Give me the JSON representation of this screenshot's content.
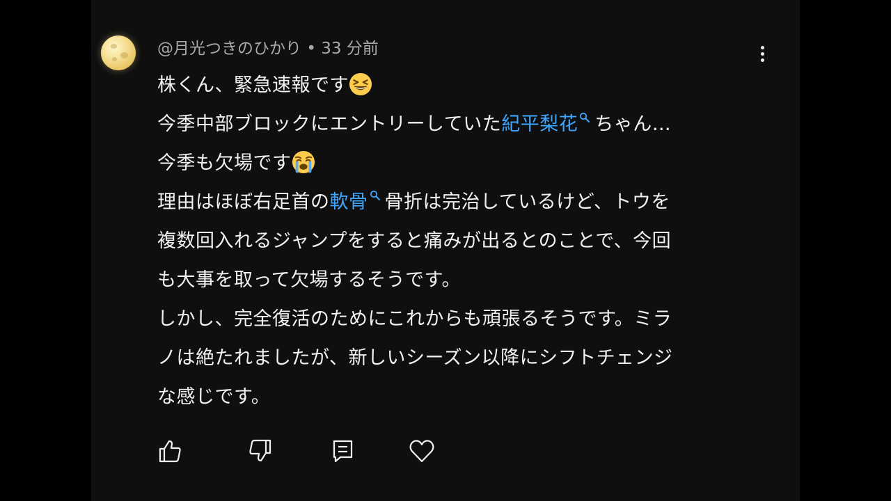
{
  "comment": {
    "author": "@月光つきのひかり",
    "separator": "•",
    "time": "33 分前",
    "lines": {
      "l1": "株くん、緊急速報です",
      "l2_pre": "今季中部ブロックにエントリーしていた",
      "l2_link": "紀平梨花",
      "l2_post": "ちゃん…",
      "l3": "今季も欠場です",
      "l4_pre": "理由はほぼ右足首の",
      "l4_link": "軟骨",
      "l4_post": "骨折は完治しているけど、トウを",
      "l5": "複数回入れるジャンプをすると痛みが出るとのことで、今回",
      "l6": "も大事を取って欠場するそうです。",
      "l7": "しかし、完全復活のためにこれからも頑張るそうです。ミラ",
      "l8": "ノは絶たれましたが、新しいシーズン以降にシフトチェンジ",
      "l9": "な感じです。"
    },
    "emojis": {
      "laugh": "grinning-squinting-face",
      "cry": "loudly-crying-face"
    }
  },
  "actions": {
    "like": "thumbs-up-icon",
    "dislike": "thumbs-down-icon",
    "reply": "reply-icon",
    "heart": "heart-icon"
  },
  "colors": {
    "background": "#0f0f0f",
    "text": "#f1f1f1",
    "meta": "#aaaaaa",
    "link": "#3ea6ff"
  }
}
